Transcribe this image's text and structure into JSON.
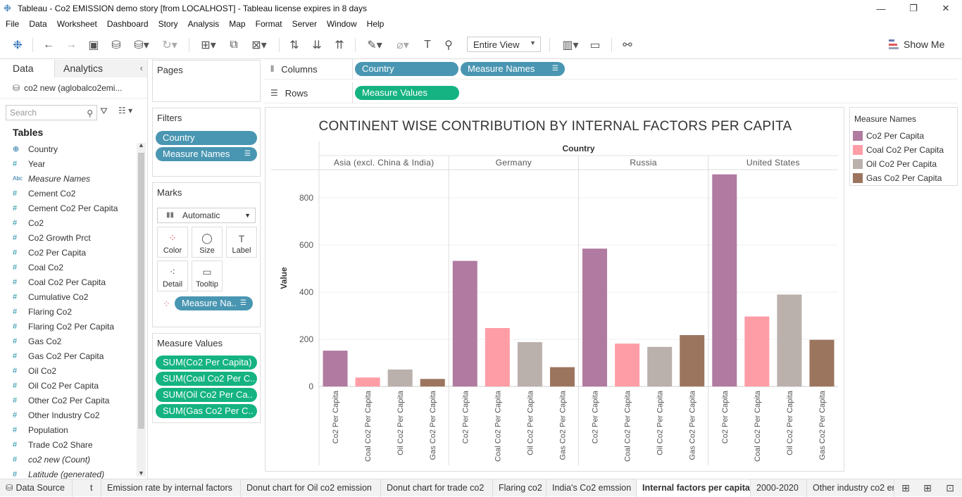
{
  "window": {
    "title": "Tableau - Co2 EMISSION demo story [from LOCALHOST] - Tableau license expires in 8 days",
    "controls": [
      "—",
      "❐",
      "✕"
    ]
  },
  "menu": [
    "File",
    "Data",
    "Worksheet",
    "Dashboard",
    "Story",
    "Analysis",
    "Map",
    "Format",
    "Server",
    "Window",
    "Help"
  ],
  "toolbar": {
    "view_select": "Entire View",
    "show_me": "Show Me"
  },
  "left_pane": {
    "tabs": [
      "Data",
      "Analytics"
    ],
    "datasource": "co2 new (aglobalco2emi...",
    "search_placeholder": "Search",
    "tables_header": "Tables",
    "fields": [
      {
        "icon": "globe",
        "name": "Country",
        "italic": false
      },
      {
        "icon": "#",
        "name": "Year",
        "italic": false
      },
      {
        "icon": "Abc",
        "name": "Measure Names",
        "italic": true
      },
      {
        "icon": "#",
        "name": "Cement Co2",
        "italic": false
      },
      {
        "icon": "#",
        "name": "Cement Co2 Per Capita",
        "italic": false
      },
      {
        "icon": "#",
        "name": "Co2",
        "italic": false
      },
      {
        "icon": "#",
        "name": "Co2 Growth Prct",
        "italic": false
      },
      {
        "icon": "#",
        "name": "Co2 Per Capita",
        "italic": false
      },
      {
        "icon": "#",
        "name": "Coal Co2",
        "italic": false
      },
      {
        "icon": "#",
        "name": "Coal Co2 Per Capita",
        "italic": false
      },
      {
        "icon": "#",
        "name": "Cumulative Co2",
        "italic": false
      },
      {
        "icon": "#",
        "name": "Flaring Co2",
        "italic": false
      },
      {
        "icon": "#",
        "name": "Flaring Co2 Per Capita",
        "italic": false
      },
      {
        "icon": "#",
        "name": "Gas Co2",
        "italic": false
      },
      {
        "icon": "#",
        "name": "Gas Co2 Per Capita",
        "italic": false
      },
      {
        "icon": "#",
        "name": "Oil Co2",
        "italic": false
      },
      {
        "icon": "#",
        "name": "Oil Co2 Per Capita",
        "italic": false
      },
      {
        "icon": "#",
        "name": "Other Co2 Per Capita",
        "italic": false
      },
      {
        "icon": "#",
        "name": "Other Industry Co2",
        "italic": false
      },
      {
        "icon": "#",
        "name": "Population",
        "italic": false
      },
      {
        "icon": "#",
        "name": "Trade Co2 Share",
        "italic": false
      },
      {
        "icon": "#",
        "name": "co2 new (Count)",
        "italic": true
      },
      {
        "icon": "#",
        "name": "Latitude (generated)",
        "italic": true
      }
    ]
  },
  "cards": {
    "pages": "Pages",
    "filters": {
      "header": "Filters",
      "pills": [
        "Country",
        "Measure Names"
      ]
    },
    "marks": {
      "header": "Marks",
      "type": "Automatic",
      "buttons": [
        "Color",
        "Size",
        "Label",
        "Detail",
        "Tooltip"
      ],
      "color_pill": "Measure Na.."
    },
    "measure_values": {
      "header": "Measure Values",
      "pills": [
        "SUM(Co2 Per Capita)",
        "SUM(Coal Co2 Per C..",
        "SUM(Oil Co2 Per Ca..",
        "SUM(Gas Co2 Per C.."
      ]
    }
  },
  "shelves": {
    "columns": {
      "label": "Columns",
      "pills": [
        "Country",
        "Measure Names"
      ]
    },
    "rows": {
      "label": "Rows",
      "pills": [
        "Measure Values"
      ]
    }
  },
  "legend": {
    "header": "Measure Names",
    "items": [
      {
        "label": "Co2 Per Capita",
        "color": "#b07aa1"
      },
      {
        "label": "Coal Co2 Per Capita",
        "color": "#ff9da7"
      },
      {
        "label": "Oil Co2 Per Capita",
        "color": "#bab0ac"
      },
      {
        "label": "Gas Co2 Per Capita",
        "color": "#9c755f"
      }
    ]
  },
  "chart_data": {
    "type": "bar",
    "title": "CONTINENT WISE CONTRIBUTION BY INTERNAL FACTORS PER CAPITA",
    "column_header": "Country",
    "ylabel": "Value",
    "ylim": [
      0,
      920
    ],
    "yticks": [
      0,
      200,
      400,
      600,
      800
    ],
    "grid": true,
    "legend_position": "right",
    "groups": [
      "Asia (excl. China & India)",
      "Germany",
      "Russia",
      "United States"
    ],
    "categories": [
      "Co2 Per Capita",
      "Coal Co2 Per Capita",
      "Oil Co2 Per Capita",
      "Gas Co2 Per Capita"
    ],
    "colors": [
      "#b07aa1",
      "#ff9da7",
      "#bab0ac",
      "#9c755f"
    ],
    "values": [
      [
        152,
        38,
        72,
        32
      ],
      [
        533,
        248,
        188,
        82
      ],
      [
        585,
        182,
        168,
        218
      ],
      [
        900,
        297,
        390,
        198
      ]
    ]
  },
  "sheets": {
    "data_source": "Data Source",
    "tabs": [
      "t",
      "Emission rate by internal factors",
      "Donut chart for Oil co2 emission",
      "Donut chart for trade co2",
      "Flaring co2",
      "India's Co2 emssion",
      "Internal factors per capita",
      "2000-2020",
      "Other industry co2 er"
    ],
    "active": "Internal factors per capita"
  }
}
